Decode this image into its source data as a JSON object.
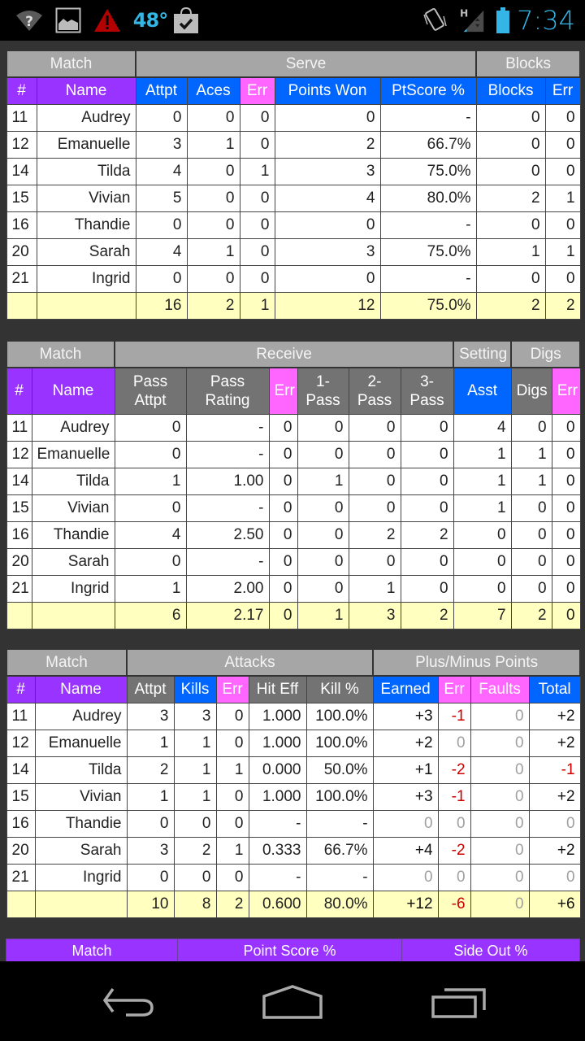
{
  "status_bar": {
    "time": "7:34",
    "temperature": "48°",
    "network_label": "H",
    "icons_left": [
      "wifi-unknown-icon",
      "image-icon",
      "warning-icon",
      "weather-temp",
      "shopping-bag-check-icon"
    ],
    "icons_right": [
      "rotation-icon",
      "signal-icon",
      "battery-icon"
    ]
  },
  "serve_table": {
    "groups": [
      "Match",
      "Serve",
      "Blocks"
    ],
    "columns": [
      "#",
      "Name",
      "Attpt",
      "Aces",
      "Err",
      "Points Won",
      "PtScore %",
      "Blocks",
      "Err"
    ],
    "rows": [
      [
        "11",
        "Audrey",
        "0",
        "0",
        "0",
        "0",
        "-",
        "0",
        "0"
      ],
      [
        "12",
        "Emanuelle",
        "3",
        "1",
        "0",
        "2",
        "66.7%",
        "0",
        "0"
      ],
      [
        "14",
        "Tilda",
        "4",
        "0",
        "1",
        "3",
        "75.0%",
        "0",
        "0"
      ],
      [
        "15",
        "Vivian",
        "5",
        "0",
        "0",
        "4",
        "80.0%",
        "2",
        "1"
      ],
      [
        "16",
        "Thandie",
        "0",
        "0",
        "0",
        "0",
        "-",
        "0",
        "0"
      ],
      [
        "20",
        "Sarah",
        "4",
        "1",
        "0",
        "3",
        "75.0%",
        "1",
        "1"
      ],
      [
        "21",
        "Ingrid",
        "0",
        "0",
        "0",
        "0",
        "-",
        "0",
        "0"
      ]
    ],
    "totals": [
      "",
      "",
      "16",
      "2",
      "1",
      "12",
      "75.0%",
      "2",
      "2"
    ]
  },
  "receive_table": {
    "groups": [
      "Match",
      "Receive",
      "Setting",
      "Digs"
    ],
    "columns": [
      "#",
      "Name",
      "Pass Attpt",
      "Pass Rating",
      "Err",
      "1- Pass",
      "2- Pass",
      "3- Pass",
      "Asst",
      "Digs",
      "Err"
    ],
    "rows": [
      [
        "11",
        "Audrey",
        "0",
        "-",
        "0",
        "0",
        "0",
        "0",
        "4",
        "0",
        "0"
      ],
      [
        "12",
        "Emanuelle",
        "0",
        "-",
        "0",
        "0",
        "0",
        "0",
        "1",
        "1",
        "0"
      ],
      [
        "14",
        "Tilda",
        "1",
        "1.00",
        "0",
        "1",
        "0",
        "0",
        "1",
        "1",
        "0"
      ],
      [
        "15",
        "Vivian",
        "0",
        "-",
        "0",
        "0",
        "0",
        "0",
        "1",
        "0",
        "0"
      ],
      [
        "16",
        "Thandie",
        "4",
        "2.50",
        "0",
        "0",
        "2",
        "2",
        "0",
        "0",
        "0"
      ],
      [
        "20",
        "Sarah",
        "0",
        "-",
        "0",
        "0",
        "0",
        "0",
        "0",
        "0",
        "0"
      ],
      [
        "21",
        "Ingrid",
        "1",
        "2.00",
        "0",
        "0",
        "1",
        "0",
        "0",
        "0",
        "0"
      ]
    ],
    "totals": [
      "",
      "",
      "6",
      "2.17",
      "0",
      "1",
      "3",
      "2",
      "7",
      "2",
      "0"
    ]
  },
  "attack_table": {
    "groups": [
      "Match",
      "Attacks",
      "Plus/Minus Points"
    ],
    "columns": [
      "#",
      "Name",
      "Attpt",
      "Kills",
      "Err",
      "Hit Eff",
      "Kill %",
      "Earned",
      "Err",
      "Faults",
      "Total"
    ],
    "rows": [
      [
        "11",
        "Audrey",
        "3",
        "3",
        "0",
        "1.000",
        "100.0%",
        "+3",
        "-1",
        "0",
        "+2"
      ],
      [
        "12",
        "Emanuelle",
        "1",
        "1",
        "0",
        "1.000",
        "100.0%",
        "+2",
        "0",
        "0",
        "+2"
      ],
      [
        "14",
        "Tilda",
        "2",
        "1",
        "1",
        "0.000",
        "50.0%",
        "+1",
        "-2",
        "0",
        "-1"
      ],
      [
        "15",
        "Vivian",
        "1",
        "1",
        "0",
        "1.000",
        "100.0%",
        "+3",
        "-1",
        "0",
        "+2"
      ],
      [
        "16",
        "Thandie",
        "0",
        "0",
        "0",
        "-",
        "-",
        "0",
        "0",
        "0",
        "0"
      ],
      [
        "20",
        "Sarah",
        "3",
        "2",
        "1",
        "0.333",
        "66.7%",
        "+4",
        "-2",
        "0",
        "+2"
      ],
      [
        "21",
        "Ingrid",
        "0",
        "0",
        "0",
        "-",
        "-",
        "0",
        "0",
        "0",
        "0"
      ]
    ],
    "totals": [
      "",
      "",
      "10",
      "8",
      "2",
      "0.600",
      "80.0%",
      "+12",
      "-6",
      "0",
      "+6"
    ]
  },
  "score_table": {
    "columns": [
      "Match",
      "Point Score %",
      "Side Out %"
    ]
  },
  "nav_bar": {
    "buttons": [
      "back",
      "home",
      "recent-apps"
    ]
  },
  "colors": {
    "name_header": "#9933ff",
    "stat_header_blue": "#0066ff",
    "error_header_pink": "#ff66ff",
    "neutral_header_gray": "#737373",
    "group_header": "#a6a6a6",
    "totals_row": "#ffffc0",
    "negative_value": "#cc0000",
    "clock": "#33b5e5"
  }
}
